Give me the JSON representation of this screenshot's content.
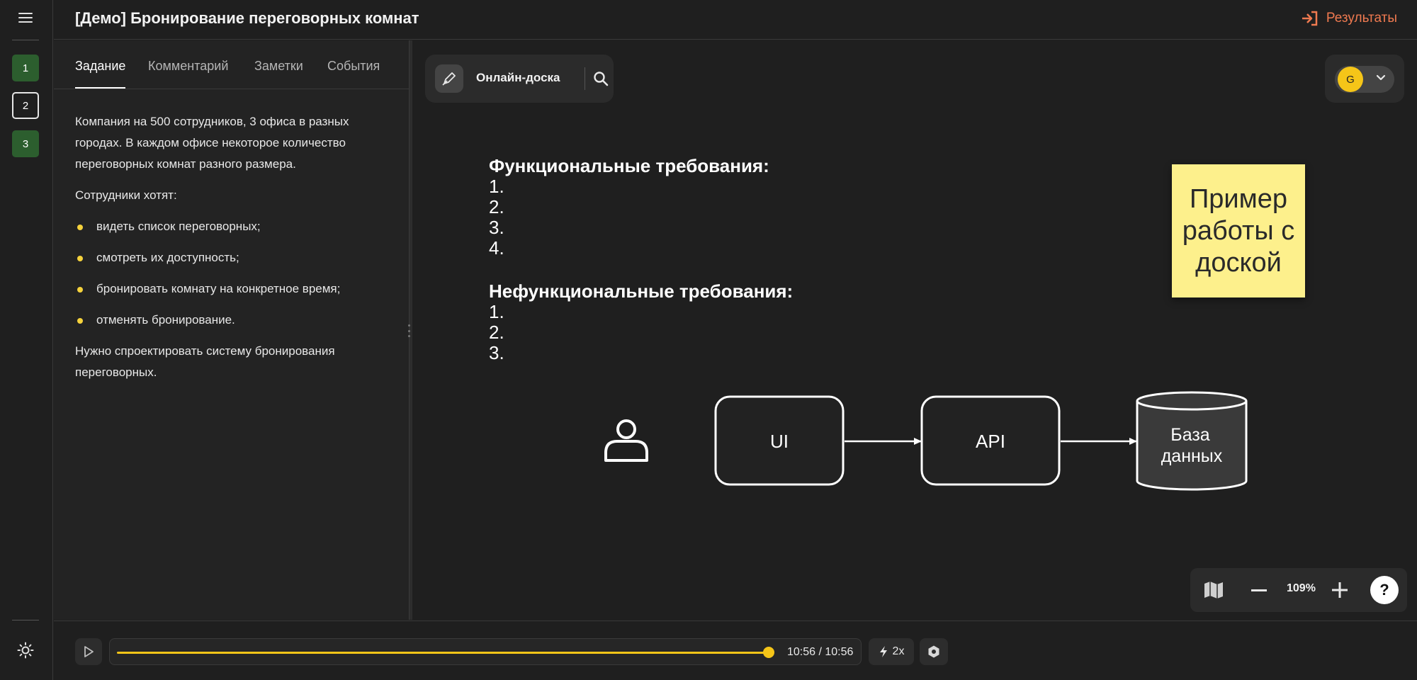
{
  "header": {
    "title": "[Демо] Бронирование переговорных комнат",
    "results_label": "Результаты"
  },
  "steps": [
    {
      "label": "1",
      "state": "done"
    },
    {
      "label": "2",
      "state": "current"
    },
    {
      "label": "3",
      "state": "done"
    }
  ],
  "tabs": [
    {
      "label": "Задание",
      "active": true
    },
    {
      "label": "Комментарий",
      "active": false
    },
    {
      "label": "Заметки",
      "active": false
    },
    {
      "label": "События",
      "active": false
    }
  ],
  "task": {
    "intro": "Компания на 500 сотрудников, 3 офиса в разных городах. В каждом офисе некоторое количество переговорных комнат разного размера.",
    "wants": "Сотрудники хотят:",
    "bullets": [
      "видеть список переговорных;",
      "смотреть их доступность;",
      "бронировать комнату на конкретное время;",
      "отменять бронирование."
    ],
    "outro": "Нужно спроектировать систему бронирования переговорных."
  },
  "board": {
    "tool_name": "Онлайн-доска",
    "user_initial": "G",
    "functional": {
      "title": "Функциональные требования:",
      "items": [
        "1.",
        "2.",
        "3.",
        "4."
      ]
    },
    "nonfunctional": {
      "title": "Нефункциональные требования:",
      "items": [
        "1.",
        "2.",
        "3."
      ]
    },
    "sticky_note": "Пример работы с доской",
    "diagram": {
      "ui_label": "UI",
      "api_label": "API",
      "db_line1": "База",
      "db_line2": "данных"
    },
    "zoom": "109%",
    "help_label": "?"
  },
  "player": {
    "time": "10:56 / 10:56",
    "speed": "2x",
    "progress": 1.0
  },
  "colors": {
    "accent": "#f07a50",
    "step_done": "#2c5e2e",
    "progress": "#f5c518",
    "sticky": "#fdf08c"
  }
}
